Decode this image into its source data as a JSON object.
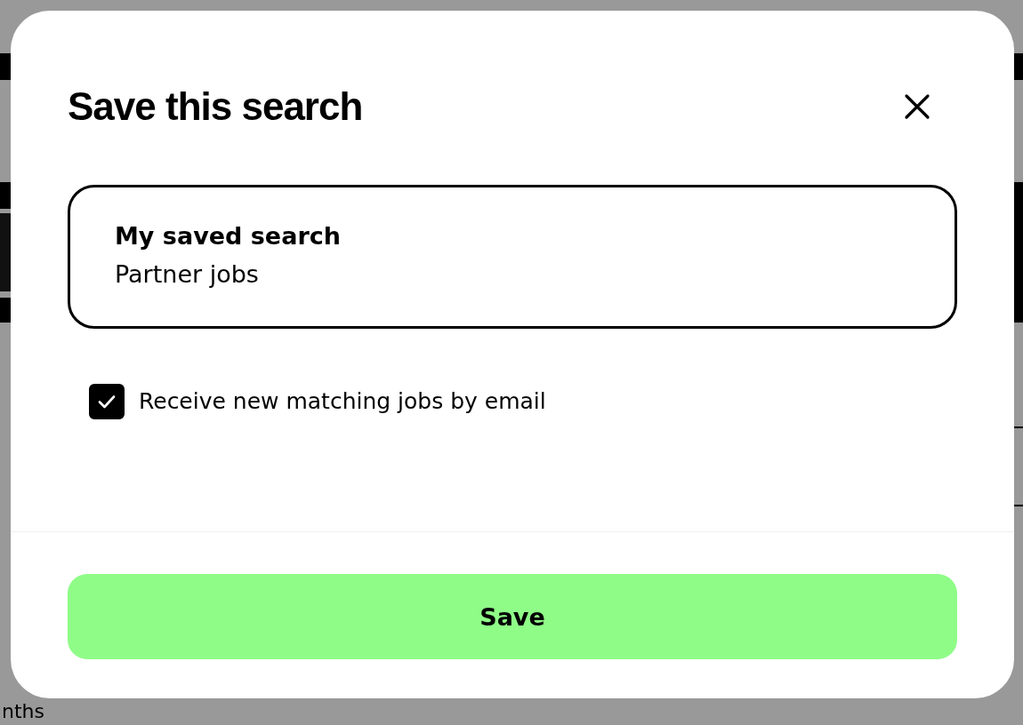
{
  "background": {
    "duration_fragment": "nths"
  },
  "dialog": {
    "title": "Save this search",
    "field": {
      "label": "My saved search",
      "value": "Partner jobs"
    },
    "email_option": {
      "label": "Receive new matching jobs by email",
      "checked": true
    },
    "save_button": "Save"
  }
}
